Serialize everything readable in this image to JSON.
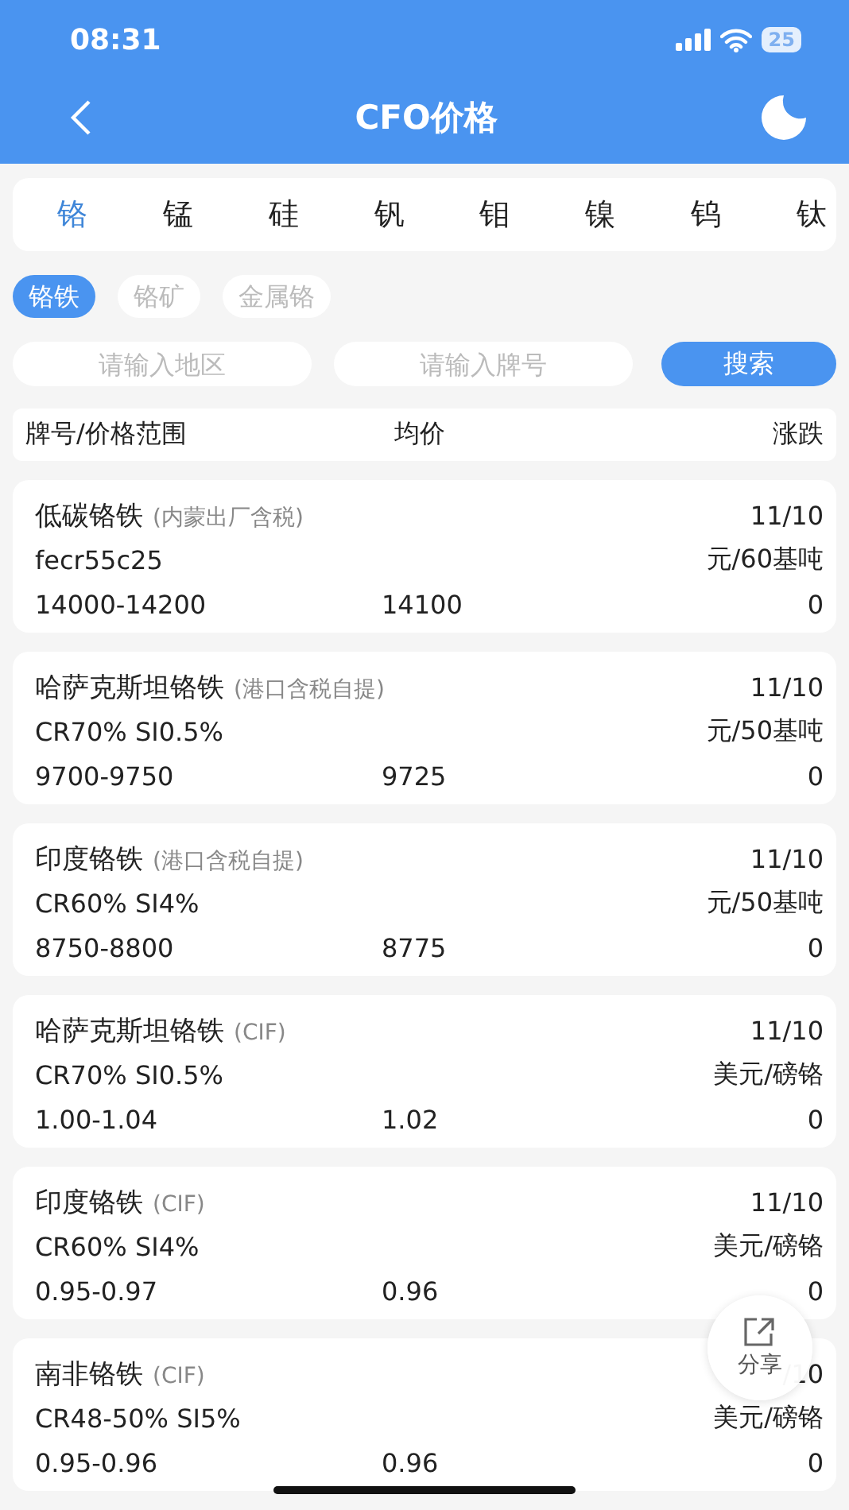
{
  "status_bar": {
    "time": "08:31",
    "battery": "25"
  },
  "nav": {
    "title": "CFO价格"
  },
  "tabs": [
    {
      "label": "铬",
      "selected": true
    },
    {
      "label": "锰",
      "selected": false
    },
    {
      "label": "硅",
      "selected": false
    },
    {
      "label": "钒",
      "selected": false
    },
    {
      "label": "钼",
      "selected": false
    },
    {
      "label": "镍",
      "selected": false
    },
    {
      "label": "钨",
      "selected": false
    },
    {
      "label": "钛",
      "selected": false
    }
  ],
  "chips": [
    {
      "label": "铬铁",
      "selected": true
    },
    {
      "label": "铬矿",
      "selected": false
    },
    {
      "label": "金属铬",
      "selected": false
    }
  ],
  "search": {
    "region": {
      "placeholder": "请输入地区"
    },
    "grade": {
      "placeholder": "请输入牌号"
    },
    "button": "搜索"
  },
  "columns": [
    "牌号/价格范围",
    "均价",
    "涨跌"
  ],
  "rows": [
    {
      "name": "低碳铬铁",
      "note": "(内蒙出厂含税)",
      "date": "11/10",
      "spec": "fecr55c25",
      "unit": "元/60基吨",
      "range": "14000-14200",
      "avg": "14100",
      "change": "0"
    },
    {
      "name": "哈萨克斯坦铬铁",
      "note": "(港口含税自提)",
      "date": "11/10",
      "spec": "CR70% SI0.5%",
      "unit": "元/50基吨",
      "range": "9700-9750",
      "avg": "9725",
      "change": "0"
    },
    {
      "name": "印度铬铁",
      "note": "(港口含税自提)",
      "date": "11/10",
      "spec": "CR60% SI4%",
      "unit": "元/50基吨",
      "range": "8750-8800",
      "avg": "8775",
      "change": "0"
    },
    {
      "name": "哈萨克斯坦铬铁",
      "note": "(CIF)",
      "date": "11/10",
      "spec": "CR70% SI0.5%",
      "unit": "美元/磅铬",
      "range": "1.00-1.04",
      "avg": "1.02",
      "change": "0"
    },
    {
      "name": "印度铬铁",
      "note": "(CIF)",
      "date": "11/10",
      "spec": "CR60% SI4%",
      "unit": "美元/磅铬",
      "range": "0.95-0.97",
      "avg": "0.96",
      "change": "0"
    },
    {
      "name": "南非铬铁",
      "note": "(CIF)",
      "date": "/10",
      "spec": "CR48-50% SI5%",
      "unit": "美元/磅铬",
      "range": "0.95-0.96",
      "avg": "0.96",
      "change": "0"
    }
  ],
  "share": {
    "label": "分享"
  }
}
